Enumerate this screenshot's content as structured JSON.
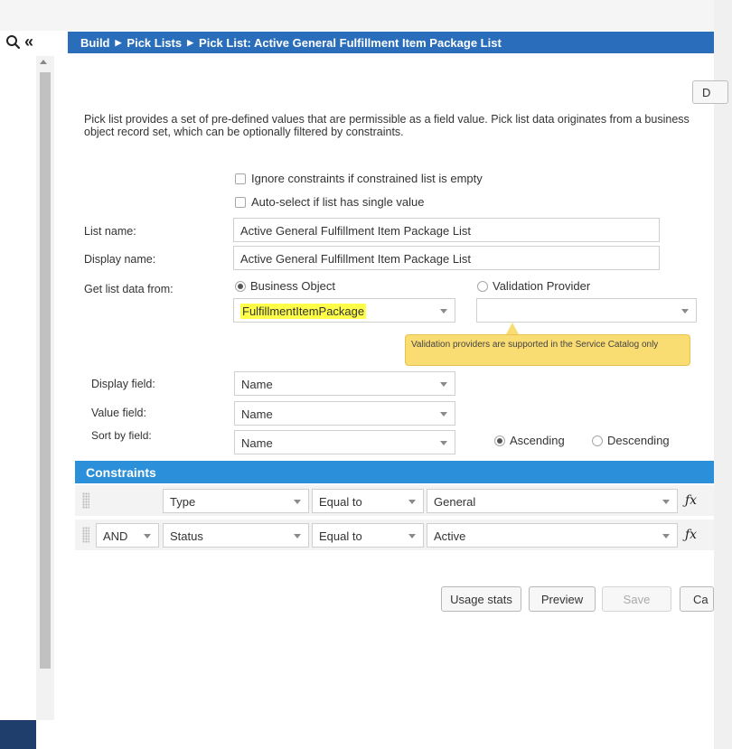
{
  "sidebar": {
    "search_icon": "search-icon",
    "collapse_label": "«"
  },
  "breadcrumb": {
    "items": [
      "Build",
      "Pick Lists",
      "Pick List: Active General Fulfillment Item Package List"
    ],
    "separator": "▶"
  },
  "toolbar": {
    "top_right_button_label": "D"
  },
  "description": "Pick list provides a set of pre-defined values that are permissible as a field value. Pick list data originates from a business object record set, which can be optionally filtered by constraints.",
  "options": {
    "ignore_constraints_label": "Ignore constraints if constrained list is empty",
    "auto_select_label": "Auto-select if list has single value"
  },
  "form": {
    "list_name_label": "List name:",
    "list_name_value": "Active General Fulfillment Item Package List",
    "display_name_label": "Display name:",
    "display_name_value": "Active General Fulfillment Item Package List",
    "get_list_label": "Get list data from:",
    "source_business_object_label": "Business Object",
    "source_validation_provider_label": "Validation Provider",
    "business_object_value": "FulfillmentItemPackage",
    "validation_provider_value": "",
    "tooltip": "Validation providers are supported in the Service Catalog only",
    "display_field_label": "Display field:",
    "display_field_value": "Name",
    "value_field_label": "Value field:",
    "value_field_value": "Name",
    "sort_field_label": "Sort by field:",
    "sort_field_value": "Name",
    "ascending_label": "Ascending",
    "descending_label": "Descending"
  },
  "constraints": {
    "header": "Constraints",
    "rows": [
      {
        "connector": "",
        "field": "Type",
        "operator": "Equal to",
        "value": "General"
      },
      {
        "connector": "AND",
        "field": "Status",
        "operator": "Equal to",
        "value": "Active"
      }
    ]
  },
  "actions": {
    "usage_stats": "Usage stats",
    "preview": "Preview",
    "save": "Save",
    "cancel": "Ca"
  },
  "colors": {
    "breadcrumb_bg": "#2a6ebb",
    "constraints_header_bg": "#2b8fd9",
    "tooltip_bg": "#f9dc72",
    "highlight": "#ffff4a"
  }
}
